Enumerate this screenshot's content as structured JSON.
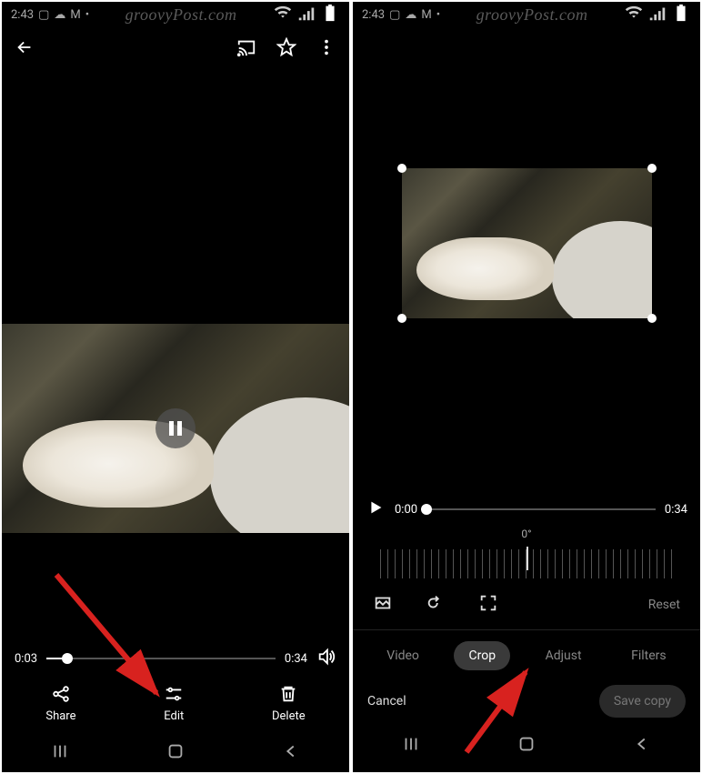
{
  "status": {
    "time": "2:43"
  },
  "watermark": "groovyPost.com",
  "left": {
    "scrubber": {
      "current": "0:03",
      "total": "0:34",
      "progressPct": 9
    },
    "actions": {
      "share": "Share",
      "edit": "Edit",
      "delete": "Delete"
    }
  },
  "right": {
    "scrubber": {
      "current": "0:00",
      "total": "0:34",
      "progressPct": 0
    },
    "rotation": "0°",
    "reset": "Reset",
    "tabs": {
      "video": "Video",
      "crop": "Crop",
      "adjust": "Adjust",
      "filters": "Filters"
    },
    "cancel": "Cancel",
    "save": "Save copy"
  }
}
